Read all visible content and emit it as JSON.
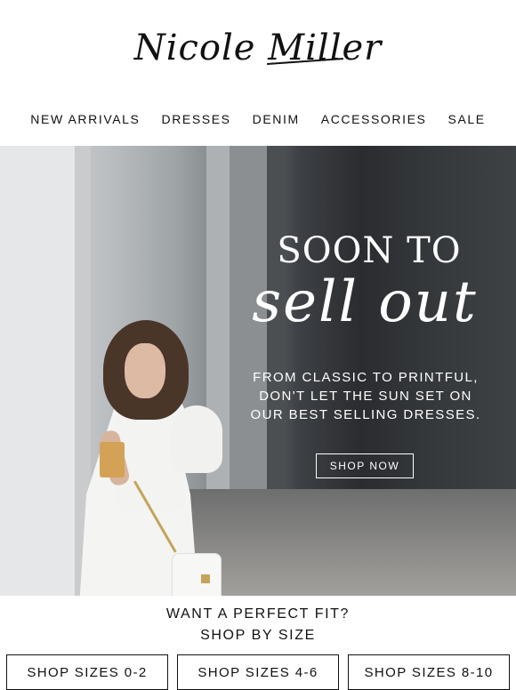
{
  "brand": {
    "logo_text": "Nicole Miller"
  },
  "nav": {
    "items": [
      "NEW ARRIVALS",
      "DRESSES",
      "DENIM",
      "ACCESSORIES",
      "SALE"
    ]
  },
  "hero": {
    "title_line1": "SOON TO",
    "title_line2": "sell out",
    "subtitle": [
      "FROM CLASSIC TO PRINTFUL,",
      "DON'T LET THE SUN SET ON",
      "OUR BEST SELLING DRESSES."
    ],
    "cta_label": "SHOP NOW"
  },
  "fit": {
    "line1": "WANT A PERFECT FIT?",
    "line2": "SHOP BY SIZE",
    "buttons": [
      "SHOP SIZES 0-2",
      "SHOP SIZES 4-6",
      "SHOP SIZES 8-10"
    ]
  }
}
